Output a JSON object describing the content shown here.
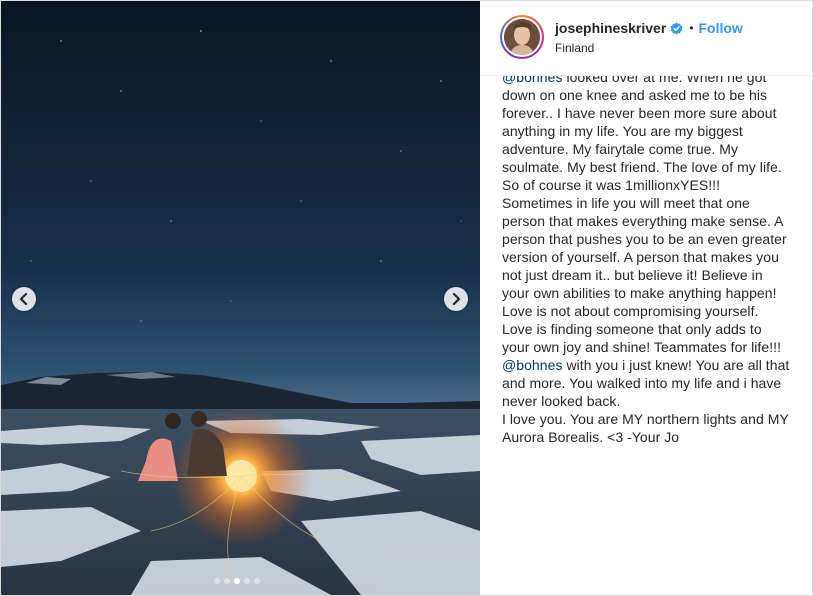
{
  "post": {
    "username": "josephineskriver",
    "separator": "•",
    "follow_label": "Follow",
    "location": "Finland",
    "caption_parts": [
      {
        "text": "@bohnes",
        "type": "mention"
      },
      {
        "text": " looked over at me. When he got down on one knee and asked me to be his forever.. I have never been more sure about anything in my life. You are my biggest adventure. My fairytale come true. My soulmate. My best friend. The love of my life. So of course it was 1millionxYES!!!\nSometimes in life you will meet that one person that makes everything make sense. A person that pushes you to be an even greater version of yourself. A person that makes you not just dream it.. but believe it! Believe in your own abilities to make anything happen!\nLove is not about compromising yourself. Love is finding someone that only adds to your own joy and shine! Teammates for life!!! ",
        "type": "text"
      },
      {
        "text": "@bohnes",
        "type": "mention"
      },
      {
        "text": " with you i just knew! You are all that and more. You walked into my life and i have never looked back.\nI love you. You are MY northern lights and MY Aurora Borealis. <3 -Your Jo",
        "type": "text"
      }
    ]
  },
  "carousel": {
    "slide_count": 5,
    "active_index": 2
  },
  "icons": {
    "prev": "chevron-left-icon",
    "next": "chevron-right-icon",
    "verified": "verified-badge-icon"
  },
  "colors": {
    "follow": "#3897f0",
    "mention": "#003569",
    "verified": "#3897f0"
  }
}
